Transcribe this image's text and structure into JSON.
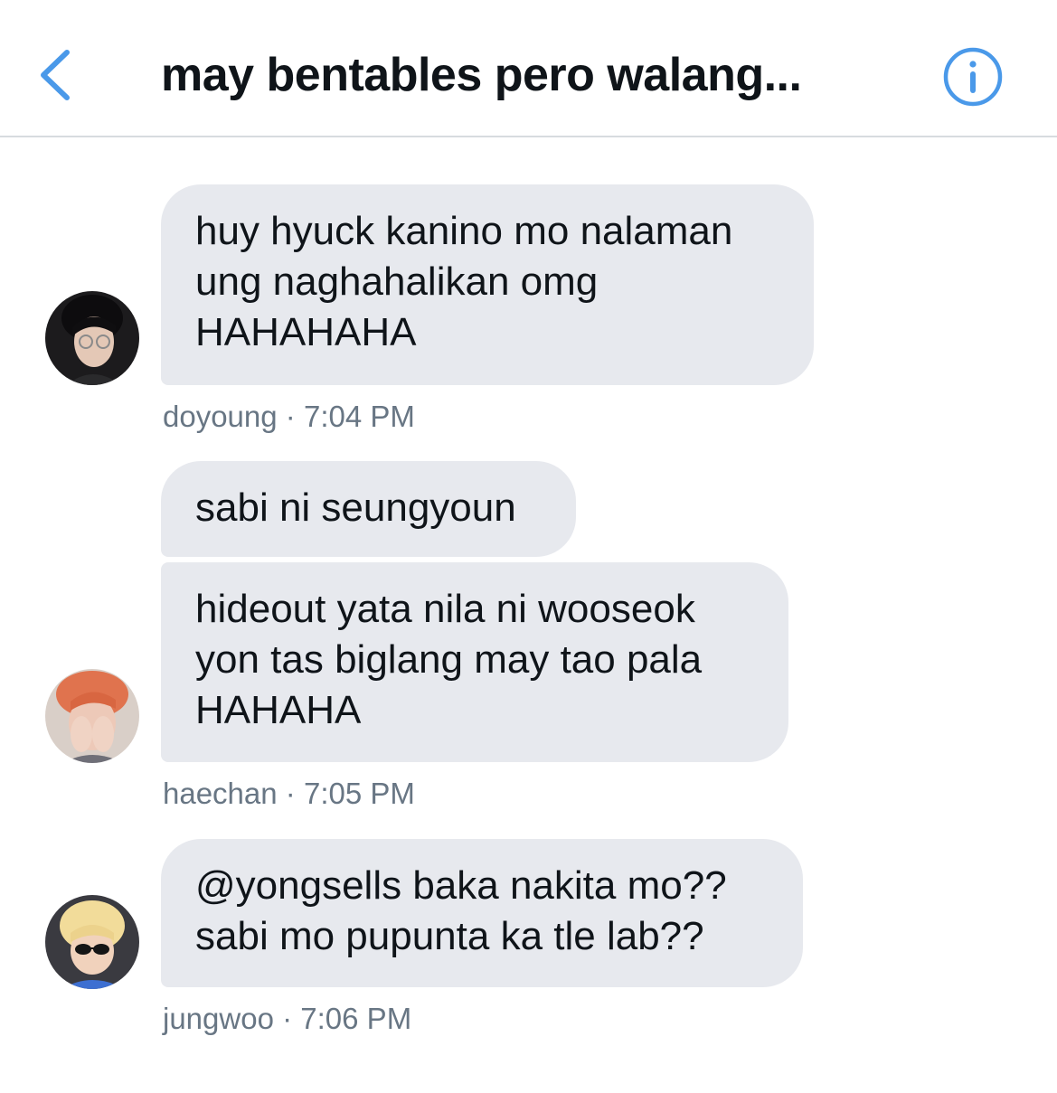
{
  "header": {
    "title": "may bentables pero walang...",
    "back_icon": "chevron-left-icon",
    "info_icon": "info-circle-icon",
    "accent_color": "#4a99e9"
  },
  "messages": [
    {
      "text": "huy hyuck kanino mo nalaman\nung naghahalikan omg\nHAHAHAHA",
      "sender": "doyoung",
      "time": "7:04 PM"
    },
    {
      "text": "sabi ni seungyoun",
      "sender": "",
      "time": ""
    },
    {
      "text": "hideout yata nila ni wooseok\nyon tas biglang may tao pala\nHAHAHA",
      "sender": "haechan",
      "time": "7:05 PM"
    },
    {
      "text": "@yongsells baka nakita mo??\nsabi mo pupunta ka tle lab??",
      "sender": "jungwoo",
      "time": "7:06 PM"
    }
  ],
  "meta_separator": "·",
  "bubble_color": "#e7e9ee"
}
